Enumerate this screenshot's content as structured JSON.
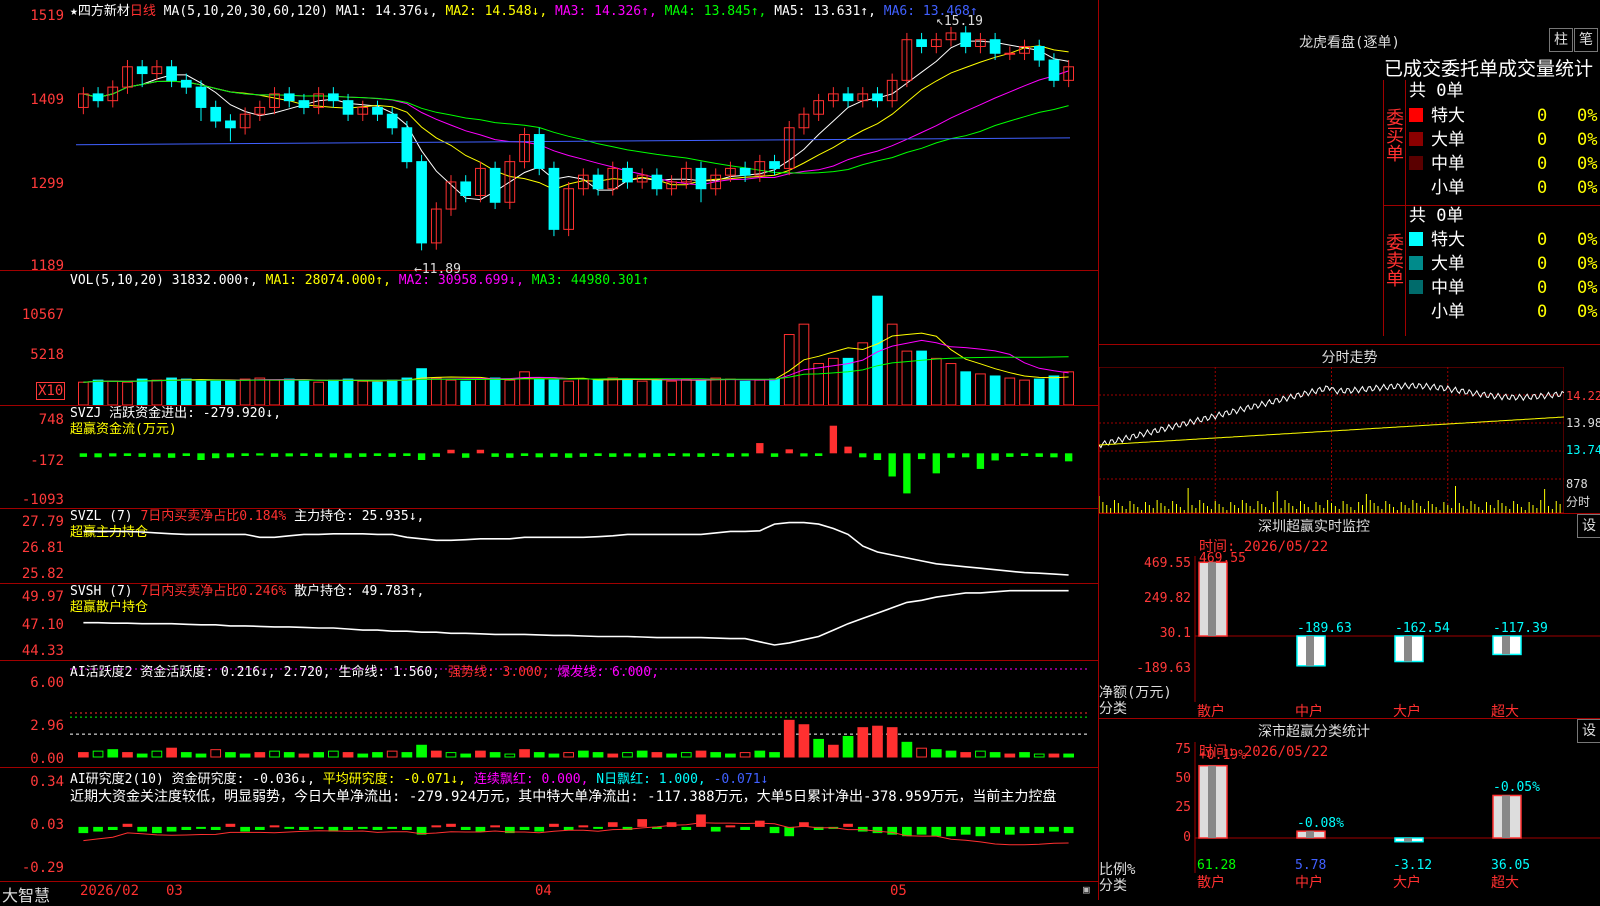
{
  "header": {
    "stock_name": "★四方新材",
    "period": "日线",
    "ma_params": "MA(5,10,20,30,60,120)",
    "ma1": "MA1: 14.376↓,",
    "ma2": "MA2: 14.548↓,",
    "ma3": "MA3: 14.326↑,",
    "ma4": "MA4: 13.845↑,",
    "ma5": "MA5: 13.631↑,",
    "ma6": "MA6: 13.468↑"
  },
  "price_axis": [
    "1519",
    "1409",
    "1299",
    "1189"
  ],
  "price_annotations": {
    "high": "15.19",
    "low": "11.89"
  },
  "vol": {
    "header_name": "VOL(5,10,20)",
    "header_val": "31832.000↑,",
    "ma1": "MA1: 28074.000↑,",
    "ma2": "MA2: 30958.699↓,",
    "ma3": "MA3: 44980.301↑",
    "axis": [
      "10567",
      "5218"
    ],
    "unit": "X10"
  },
  "svzj": {
    "header_line1": "SVZJ  活跃资金进出: -279.920↓,",
    "header_line2": "超赢资金流(万元)",
    "axis": [
      "748",
      "-172",
      "-1093"
    ]
  },
  "svzl": {
    "name": "SVZL (7)",
    "ratio": "7日内买卖净占比0.184%",
    "hold": "主力持仓: 25.935↓,",
    "line2": "超赢主力持仓",
    "axis": [
      "27.79",
      "26.81",
      "25.82"
    ]
  },
  "svsh": {
    "name": "SVSH (7)",
    "ratio": "7日内买卖净占比0.246%",
    "hold": "散户持仓: 49.783↑,",
    "line2": "超赢散户持仓",
    "axis": [
      "49.97",
      "47.10",
      "44.33"
    ]
  },
  "ai_active": {
    "name": "AI活跃度2",
    "v1": "资金活跃度: 0.216↓,",
    "v2": "2.720,",
    "v3": "生命线: 1.560,",
    "v4": "强势线: 3.000,",
    "v5": "爆发线: 6.000,",
    "axis": [
      "6.00",
      "2.96",
      "0.00"
    ]
  },
  "ai_research": {
    "name": "AI研究度2(10)",
    "v1": "资金研究度: -0.036↓,",
    "v2": "平均研究度: -0.071↓,",
    "v3": "连续飘红: 0.000,",
    "v4": "N日飘红: 1.000,",
    "v5": "-0.071↓",
    "comment": "近期大资金关注度较低，明显弱势，今日大单净流出: -279.924万元，其中特大单净流出: -117.388万元，大单5日累计净出-378.959万元，当前主力控盘",
    "axis": [
      "0.34",
      "0.03",
      "-0.29"
    ]
  },
  "bottom_bar": {
    "brand": "大智慧",
    "dates": [
      "2026/02",
      "03",
      "04",
      "05"
    ]
  },
  "lhb": {
    "title": "龙虎看盘(逐单)",
    "btn1": "柱",
    "btn2": "笔",
    "subtitle": "已成交委托单成交量统计",
    "buy_label": "委买单",
    "sell_label": "委卖单",
    "buy_total": "共 0单",
    "sell_total": "共 0单",
    "buy_rows": [
      {
        "name": "特大",
        "count": "0",
        "pct": "0%",
        "color": "#ff0000"
      },
      {
        "name": "大单",
        "count": "0",
        "pct": "0%",
        "color": "#8b0000"
      },
      {
        "name": "中单",
        "count": "0",
        "pct": "0%",
        "color": "#5a0000"
      },
      {
        "name": "小单",
        "count": "0",
        "pct": "0%",
        "color": ""
      }
    ],
    "sell_rows": [
      {
        "name": "特大",
        "count": "0",
        "pct": "0%",
        "color": "#00ffff"
      },
      {
        "name": "大单",
        "count": "0",
        "pct": "0%",
        "color": "#008b8b"
      },
      {
        "name": "中单",
        "count": "0",
        "pct": "0%",
        "color": "#006b6b"
      },
      {
        "name": "小单",
        "count": "0",
        "pct": "0%",
        "color": ""
      }
    ]
  },
  "fenshi": {
    "title": "分时走势",
    "axis": [
      "14.22",
      "13.98",
      "13.74",
      "878",
      "分时"
    ]
  },
  "monitor": {
    "title": "深圳超赢实时监控",
    "btn": "设",
    "time": "时间: 2026/05/22",
    "axis": [
      "469.55",
      "249.82",
      "30.1",
      "-189.63"
    ],
    "ylabel": "净额(万元)",
    "xlabel": "分类",
    "values": [
      "469.55",
      "-189.63",
      "-162.54",
      "-117.39"
    ],
    "cats": [
      "散户",
      "中户",
      "大户",
      "超大"
    ]
  },
  "classify": {
    "title": "深市超赢分类统计",
    "btn": "设",
    "time": "时间: 2026/05/22",
    "axis": [
      "75",
      "50",
      "25",
      "0"
    ],
    "ylabel": "比例%",
    "xlabel": "分类",
    "top_labels": [
      "+0.19%",
      "-0.08%",
      "",
      "-0.05%"
    ],
    "values": [
      "61.28",
      "5.78",
      "-3.12",
      "36.05"
    ],
    "cats": [
      "散户",
      "中户",
      "大户",
      "超大"
    ]
  },
  "chart_data": [
    {
      "type": "candlestick",
      "candles": [
        [
          14.0,
          14.2,
          13.9,
          14.3
        ],
        [
          14.2,
          14.1,
          14.0,
          14.3
        ],
        [
          14.1,
          14.3,
          14.0,
          14.4
        ],
        [
          14.3,
          14.6,
          14.2,
          14.7
        ],
        [
          14.6,
          14.5,
          14.3,
          14.7
        ],
        [
          14.5,
          14.6,
          14.4,
          14.7
        ],
        [
          14.6,
          14.4,
          14.3,
          14.7
        ],
        [
          14.4,
          14.3,
          14.2,
          14.5
        ],
        [
          14.3,
          14.0,
          13.8,
          14.4
        ],
        [
          14.0,
          13.8,
          13.7,
          14.1
        ],
        [
          13.8,
          13.7,
          13.5,
          13.9
        ],
        [
          13.7,
          13.9,
          13.6,
          14.0
        ],
        [
          13.9,
          14.0,
          13.8,
          14.1
        ],
        [
          14.0,
          14.2,
          13.9,
          14.3
        ],
        [
          14.2,
          14.1,
          14.0,
          14.3
        ],
        [
          14.1,
          14.0,
          13.9,
          14.2
        ],
        [
          14.0,
          14.2,
          13.9,
          14.3
        ],
        [
          14.2,
          14.1,
          14.0,
          14.3
        ],
        [
          14.1,
          13.9,
          13.8,
          14.2
        ],
        [
          13.9,
          14.0,
          13.8,
          14.1
        ],
        [
          14.0,
          13.9,
          13.8,
          14.1
        ],
        [
          13.9,
          13.7,
          13.6,
          14.0
        ],
        [
          13.7,
          13.2,
          13.1,
          13.8
        ],
        [
          13.2,
          12.0,
          11.89,
          13.3
        ],
        [
          12.0,
          12.5,
          11.9,
          12.6
        ],
        [
          12.5,
          12.9,
          12.4,
          13.0
        ],
        [
          12.9,
          12.7,
          12.6,
          13.0
        ],
        [
          12.7,
          13.1,
          12.6,
          13.2
        ],
        [
          13.1,
          12.6,
          12.5,
          13.2
        ],
        [
          12.6,
          13.2,
          12.5,
          13.3
        ],
        [
          13.2,
          13.6,
          13.1,
          13.7
        ],
        [
          13.6,
          13.1,
          13.0,
          13.7
        ],
        [
          13.1,
          12.2,
          12.1,
          13.2
        ],
        [
          12.2,
          12.8,
          12.1,
          12.9
        ],
        [
          12.8,
          13.0,
          12.7,
          13.1
        ],
        [
          13.0,
          12.8,
          12.7,
          13.1
        ],
        [
          12.8,
          13.1,
          12.7,
          13.2
        ],
        [
          13.1,
          12.9,
          12.8,
          13.2
        ],
        [
          12.9,
          13.0,
          12.8,
          13.1
        ],
        [
          13.0,
          12.8,
          12.7,
          13.1
        ],
        [
          12.8,
          12.9,
          12.7,
          13.0
        ],
        [
          12.9,
          13.1,
          12.8,
          13.2
        ],
        [
          13.1,
          12.8,
          12.6,
          13.2
        ],
        [
          12.8,
          13.0,
          12.7,
          13.1
        ],
        [
          13.0,
          13.1,
          12.9,
          13.2
        ],
        [
          13.1,
          13.0,
          12.9,
          13.2
        ],
        [
          13.0,
          13.2,
          12.9,
          13.3
        ],
        [
          13.2,
          13.1,
          13.0,
          13.3
        ],
        [
          13.1,
          13.7,
          13.0,
          13.8
        ],
        [
          13.7,
          13.9,
          13.6,
          14.0
        ],
        [
          13.9,
          14.1,
          13.8,
          14.2
        ],
        [
          14.1,
          14.2,
          14.0,
          14.3
        ],
        [
          14.2,
          14.1,
          14.0,
          14.3
        ],
        [
          14.1,
          14.2,
          14.0,
          14.3
        ],
        [
          14.2,
          14.1,
          14.0,
          14.3
        ],
        [
          14.1,
          14.4,
          14.0,
          14.5
        ],
        [
          14.4,
          15.0,
          14.3,
          15.1
        ],
        [
          15.0,
          14.9,
          14.8,
          15.1
        ],
        [
          14.9,
          15.0,
          14.8,
          15.1
        ],
        [
          15.0,
          15.1,
          14.9,
          15.19
        ],
        [
          15.1,
          14.9,
          14.8,
          15.2
        ],
        [
          14.9,
          15.0,
          14.8,
          15.1
        ],
        [
          15.0,
          14.8,
          14.7,
          15.1
        ],
        [
          14.8,
          14.8,
          14.7,
          14.9
        ],
        [
          14.8,
          14.9,
          14.7,
          15.0
        ],
        [
          14.9,
          14.7,
          14.6,
          15.0
        ],
        [
          14.7,
          14.4,
          14.3,
          14.8
        ],
        [
          14.4,
          14.6,
          14.3,
          14.7
        ]
      ]
    },
    {
      "type": "bar",
      "name": "VOL",
      "values": [
        2.2,
        2.4,
        2.3,
        2.2,
        2.5,
        2.4,
        2.6,
        2.5,
        2.3,
        2.4,
        2.3,
        2.5,
        2.6,
        2.4,
        2.5,
        2.3,
        2.2,
        2.4,
        2.5,
        2.3,
        2.2,
        2.4,
        2.6,
        3.5,
        2.6,
        2.4,
        2.3,
        2.5,
        2.6,
        2.4,
        3.2,
        2.5,
        2.4,
        2.3,
        2.5,
        2.4,
        2.6,
        2.5,
        2.3,
        2.4,
        2.3,
        2.5,
        2.4,
        2.6,
        2.5,
        2.3,
        2.4,
        2.5,
        6.8,
        7.8,
        4.0,
        4.5,
        4.5,
        6.0,
        10.5,
        7.8,
        5.2,
        5.2,
        4.5,
        4.0,
        3.2,
        3.0,
        2.8,
        2.6,
        2.4,
        2.5,
        2.8,
        3.2
      ]
    },
    {
      "type": "bar",
      "name": "SVZJ",
      "values": [
        -80,
        -90,
        -70,
        -60,
        -80,
        -90,
        -100,
        -60,
        -150,
        -110,
        -90,
        -60,
        -50,
        -80,
        -70,
        -60,
        -80,
        -90,
        -100,
        -80,
        -60,
        -80,
        -60,
        -150,
        -80,
        80,
        -100,
        80,
        -80,
        -100,
        -60,
        -90,
        -80,
        -100,
        -80,
        -60,
        -80,
        -70,
        -90,
        -80,
        -60,
        -70,
        -80,
        -60,
        -80,
        -70,
        230,
        -80,
        90,
        -70,
        -60,
        620,
        150,
        -90,
        -150,
        -520,
        -900,
        -130,
        -450,
        -100,
        -90,
        -350,
        -160,
        -80,
        -60,
        -80,
        -90,
        -180
      ]
    },
    {
      "type": "line",
      "name": "SVZL",
      "values": [
        27.3,
        27.3,
        27.3,
        27.3,
        27.28,
        27.25,
        27.22,
        27.2,
        27.2,
        27.2,
        27.2,
        27.2,
        27.1,
        27.1,
        27.15,
        27.2,
        27.2,
        27.22,
        27.22,
        27.22,
        27.2,
        27.2,
        27.1,
        27.05,
        27.0,
        27.0,
        27.02,
        27.05,
        27.05,
        27.05,
        27.1,
        27.1,
        27.1,
        27.1,
        27.1,
        27.12,
        27.15,
        27.2,
        27.2,
        27.2,
        27.2,
        27.2,
        27.2,
        27.25,
        27.3,
        27.3,
        27.32,
        27.55,
        27.6,
        27.6,
        27.55,
        27.4,
        27.2,
        26.8,
        26.6,
        26.5,
        26.4,
        26.3,
        26.2,
        26.15,
        26.1,
        26.05,
        26.0,
        25.95,
        25.9,
        25.88,
        25.85,
        25.82
      ]
    },
    {
      "type": "line",
      "name": "SVSH",
      "values": [
        46.9,
        46.9,
        46.85,
        46.85,
        46.8,
        46.8,
        46.8,
        46.75,
        46.7,
        46.7,
        46.6,
        46.6,
        46.55,
        46.5,
        46.5,
        46.45,
        46.4,
        46.4,
        46.3,
        46.2,
        46.2,
        46.1,
        46.1,
        46.0,
        46.0,
        45.9,
        45.9,
        45.85,
        45.8,
        45.8,
        45.8,
        45.75,
        45.7,
        45.7,
        45.65,
        45.6,
        45.6,
        45.6,
        45.55,
        45.5,
        45.5,
        45.5,
        45.5,
        45.45,
        45.4,
        45.4,
        45.1,
        44.8,
        45.0,
        45.3,
        45.6,
        46.2,
        46.8,
        47.3,
        47.8,
        48.3,
        48.8,
        49.0,
        49.3,
        49.5,
        49.7,
        49.7,
        49.8,
        49.9,
        49.9,
        49.9,
        49.9,
        49.9
      ]
    },
    {
      "type": "bar",
      "name": "AI活跃度",
      "values": [
        0.3,
        0.4,
        0.5,
        0.3,
        0.2,
        0.4,
        0.6,
        0.3,
        0.2,
        0.5,
        0.3,
        0.2,
        0.3,
        0.4,
        0.3,
        0.2,
        0.3,
        0.4,
        0.3,
        0.2,
        0.3,
        0.4,
        0.3,
        0.8,
        0.4,
        0.3,
        0.2,
        0.4,
        0.3,
        0.2,
        0.5,
        0.3,
        0.2,
        0.3,
        0.4,
        0.3,
        0.2,
        0.3,
        0.4,
        0.3,
        0.2,
        0.3,
        0.4,
        0.3,
        0.2,
        0.3,
        0.4,
        0.3,
        2.5,
        2.2,
        1.2,
        0.8,
        1.4,
        2.0,
        2.1,
        2.0,
        1.0,
        0.6,
        0.5,
        0.4,
        0.3,
        0.4,
        0.3,
        0.2,
        0.3,
        0.2,
        0.2,
        0.2
      ]
    },
    {
      "type": "bar",
      "name": "AI研究度",
      "values": [
        -0.04,
        -0.03,
        -0.02,
        0.02,
        -0.03,
        -0.04,
        -0.03,
        -0.02,
        -0.01,
        -0.02,
        0.02,
        -0.03,
        -0.02,
        0.01,
        -0.01,
        -0.02,
        -0.01,
        -0.03,
        -0.02,
        -0.01,
        -0.02,
        -0.01,
        -0.02,
        -0.05,
        0.01,
        0.02,
        -0.02,
        -0.03,
        0.01,
        -0.04,
        -0.02,
        -0.03,
        0.02,
        -0.02,
        0.01,
        -0.01,
        0.03,
        -0.02,
        0.05,
        -0.01,
        0.03,
        -0.02,
        0.08,
        -0.03,
        0.01,
        -0.02,
        0.04,
        -0.04,
        -0.06,
        0.03,
        -0.02,
        -0.01,
        0.02,
        -0.03,
        -0.04,
        -0.05,
        -0.06,
        -0.05,
        -0.06,
        -0.06,
        -0.05,
        -0.06,
        -0.04,
        -0.05,
        -0.04,
        -0.04,
        -0.03,
        -0.04
      ]
    },
    {
      "type": "bar",
      "title": "深圳超赢实时监控",
      "categories": [
        "散户",
        "中户",
        "大户",
        "超大"
      ],
      "values": [
        469.55,
        -189.63,
        -162.54,
        -117.39
      ],
      "ylabel": "净额(万元)"
    },
    {
      "type": "bar",
      "title": "深市超赢分类统计",
      "categories": [
        "散户",
        "中户",
        "大户",
        "超大"
      ],
      "values": [
        61.28,
        5.78,
        -3.12,
        36.05
      ],
      "ylabel": "比例%"
    }
  ]
}
